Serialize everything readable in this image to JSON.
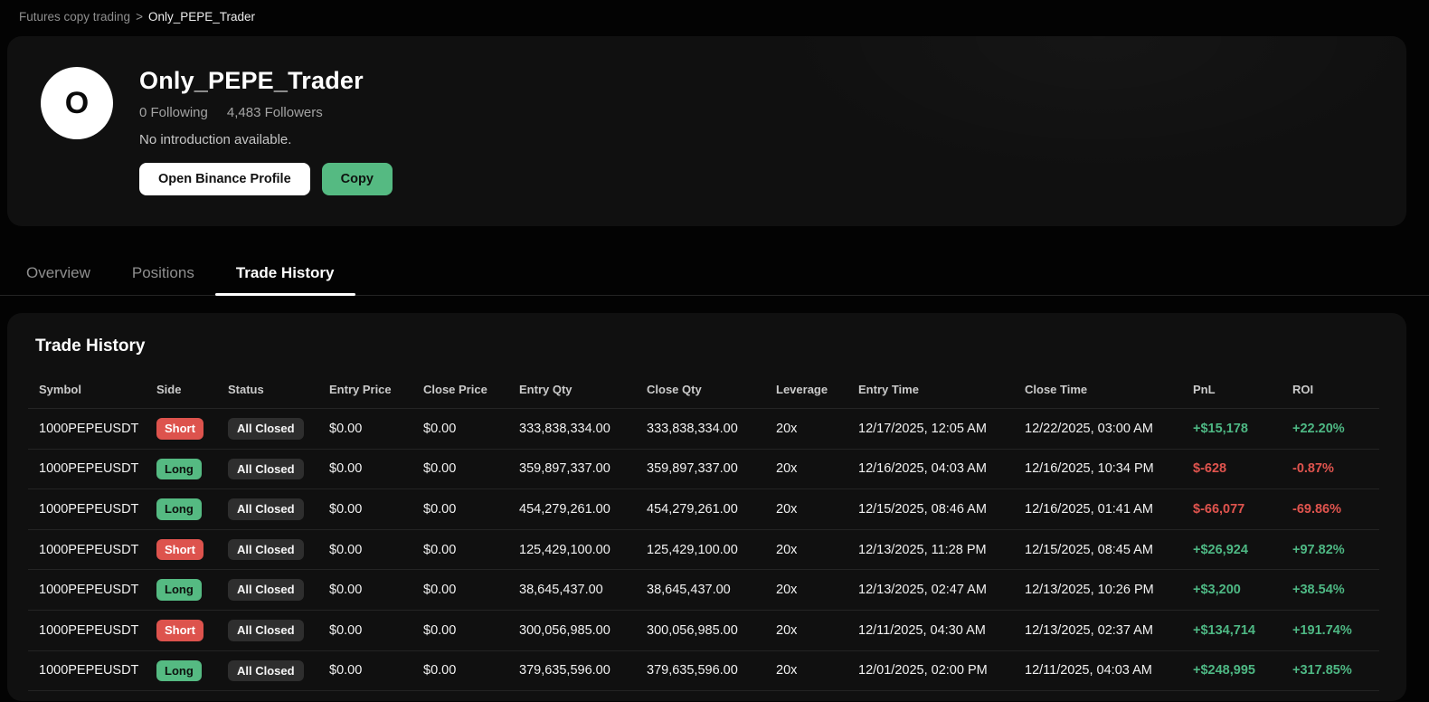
{
  "breadcrumb": {
    "parent": "Futures copy trading",
    "separator": ">",
    "current": "Only_PEPE_Trader"
  },
  "profile": {
    "avatar_letter": "O",
    "name": "Only_PEPE_Trader",
    "following": "0 Following",
    "followers": "4,483 Followers",
    "introduction": "No introduction available.",
    "open_profile_button": "Open Binance Profile",
    "copy_button": "Copy"
  },
  "tabs": [
    {
      "label": "Overview",
      "active": false
    },
    {
      "label": "Positions",
      "active": false
    },
    {
      "label": "Trade History",
      "active": true
    }
  ],
  "trade_history": {
    "title": "Trade History",
    "columns": [
      "Symbol",
      "Side",
      "Status",
      "Entry Price",
      "Close Price",
      "Entry Qty",
      "Close Qty",
      "Leverage",
      "Entry Time",
      "Close Time",
      "PnL",
      "ROI"
    ],
    "rows": [
      {
        "symbol": "1000PEPEUSDT",
        "side": "Short",
        "status": "All Closed",
        "entry_price": "$0.00",
        "close_price": "$0.00",
        "entry_qty": "333,838,334.00",
        "close_qty": "333,838,334.00",
        "leverage": "20x",
        "entry_time": "12/17/2025, 12:05 AM",
        "close_time": "12/22/2025, 03:00 AM",
        "pnl": "+$15,178",
        "roi": "+22.20%",
        "sign": "pos"
      },
      {
        "symbol": "1000PEPEUSDT",
        "side": "Long",
        "status": "All Closed",
        "entry_price": "$0.00",
        "close_price": "$0.00",
        "entry_qty": "359,897,337.00",
        "close_qty": "359,897,337.00",
        "leverage": "20x",
        "entry_time": "12/16/2025, 04:03 AM",
        "close_time": "12/16/2025, 10:34 PM",
        "pnl": "$-628",
        "roi": "-0.87%",
        "sign": "neg"
      },
      {
        "symbol": "1000PEPEUSDT",
        "side": "Long",
        "status": "All Closed",
        "entry_price": "$0.00",
        "close_price": "$0.00",
        "entry_qty": "454,279,261.00",
        "close_qty": "454,279,261.00",
        "leverage": "20x",
        "entry_time": "12/15/2025, 08:46 AM",
        "close_time": "12/16/2025, 01:41 AM",
        "pnl": "$-66,077",
        "roi": "-69.86%",
        "sign": "neg"
      },
      {
        "symbol": "1000PEPEUSDT",
        "side": "Short",
        "status": "All Closed",
        "entry_price": "$0.00",
        "close_price": "$0.00",
        "entry_qty": "125,429,100.00",
        "close_qty": "125,429,100.00",
        "leverage": "20x",
        "entry_time": "12/13/2025, 11:28 PM",
        "close_time": "12/15/2025, 08:45 AM",
        "pnl": "+$26,924",
        "roi": "+97.82%",
        "sign": "pos"
      },
      {
        "symbol": "1000PEPEUSDT",
        "side": "Long",
        "status": "All Closed",
        "entry_price": "$0.00",
        "close_price": "$0.00",
        "entry_qty": "38,645,437.00",
        "close_qty": "38,645,437.00",
        "leverage": "20x",
        "entry_time": "12/13/2025, 02:47 AM",
        "close_time": "12/13/2025, 10:26 PM",
        "pnl": "+$3,200",
        "roi": "+38.54%",
        "sign": "pos"
      },
      {
        "symbol": "1000PEPEUSDT",
        "side": "Short",
        "status": "All Closed",
        "entry_price": "$0.00",
        "close_price": "$0.00",
        "entry_qty": "300,056,985.00",
        "close_qty": "300,056,985.00",
        "leverage": "20x",
        "entry_time": "12/11/2025, 04:30 AM",
        "close_time": "12/13/2025, 02:37 AM",
        "pnl": "+$134,714",
        "roi": "+191.74%",
        "sign": "pos"
      },
      {
        "symbol": "1000PEPEUSDT",
        "side": "Long",
        "status": "All Closed",
        "entry_price": "$0.00",
        "close_price": "$0.00",
        "entry_qty": "379,635,596.00",
        "close_qty": "379,635,596.00",
        "leverage": "20x",
        "entry_time": "12/01/2025, 02:00 PM",
        "close_time": "12/11/2025, 04:03 AM",
        "pnl": "+$248,995",
        "roi": "+317.85%",
        "sign": "pos"
      }
    ]
  },
  "colors": {
    "positive_green": "#4eb884",
    "negative_red": "#e0544e",
    "badge_long_bg": "#55ba82",
    "badge_short_bg": "#dd534d",
    "badge_status_bg": "#2e2e2e",
    "accent_button_green": "#55ba82"
  }
}
